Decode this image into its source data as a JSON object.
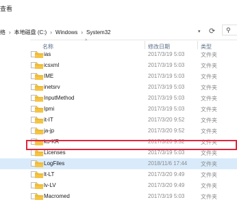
{
  "ribbon": {
    "view_tab": "查看"
  },
  "breadcrumb": {
    "items": [
      "络",
      "本地磁盘 (C:)",
      "Windows",
      "System32"
    ],
    "separator": "›"
  },
  "columns": {
    "name": "名称",
    "date": "修改日期",
    "type": "类型"
  },
  "files": [
    {
      "name": "ias",
      "date": "2017/3/19 5:03",
      "type": "文件夹"
    },
    {
      "name": "icsxml",
      "date": "2017/3/19 5:03",
      "type": "文件夹"
    },
    {
      "name": "IME",
      "date": "2017/3/19 5:03",
      "type": "文件夹"
    },
    {
      "name": "inetsrv",
      "date": "2017/3/19 5:03",
      "type": "文件夹"
    },
    {
      "name": "InputMethod",
      "date": "2017/3/19 5:03",
      "type": "文件夹"
    },
    {
      "name": "Ipmi",
      "date": "2017/3/19 5:03",
      "type": "文件夹"
    },
    {
      "name": "it-IT",
      "date": "2017/3/20 9:52",
      "type": "文件夹"
    },
    {
      "name": "ja-jp",
      "date": "2017/3/20 9:52",
      "type": "文件夹"
    },
    {
      "name": "ko-KR",
      "date": "2017/3/20 9:52",
      "type": "文件夹"
    },
    {
      "name": "Licenses",
      "date": "2017/3/19 5:03",
      "type": "文件夹"
    },
    {
      "name": "LogFiles",
      "date": "2018/11/6 17:44",
      "type": "文件夹"
    },
    {
      "name": "lt-LT",
      "date": "2017/3/20 9:49",
      "type": "文件夹"
    },
    {
      "name": "lv-LV",
      "date": "2017/3/20 9:49",
      "type": "文件夹"
    },
    {
      "name": "Macromed",
      "date": "2017/3/19 5:03",
      "type": "文件夹"
    }
  ],
  "highlighted_file": "LogFiles",
  "colors": {
    "folder": "#f5c443",
    "folder_dark": "#e0a92a",
    "highlight_border": "#e0243c",
    "selection": "#d9ebfb",
    "header_text": "#5a6f8a"
  },
  "icons": {
    "dropdown": "▾",
    "refresh": "⟳",
    "search": "⚲",
    "sort": "^"
  }
}
